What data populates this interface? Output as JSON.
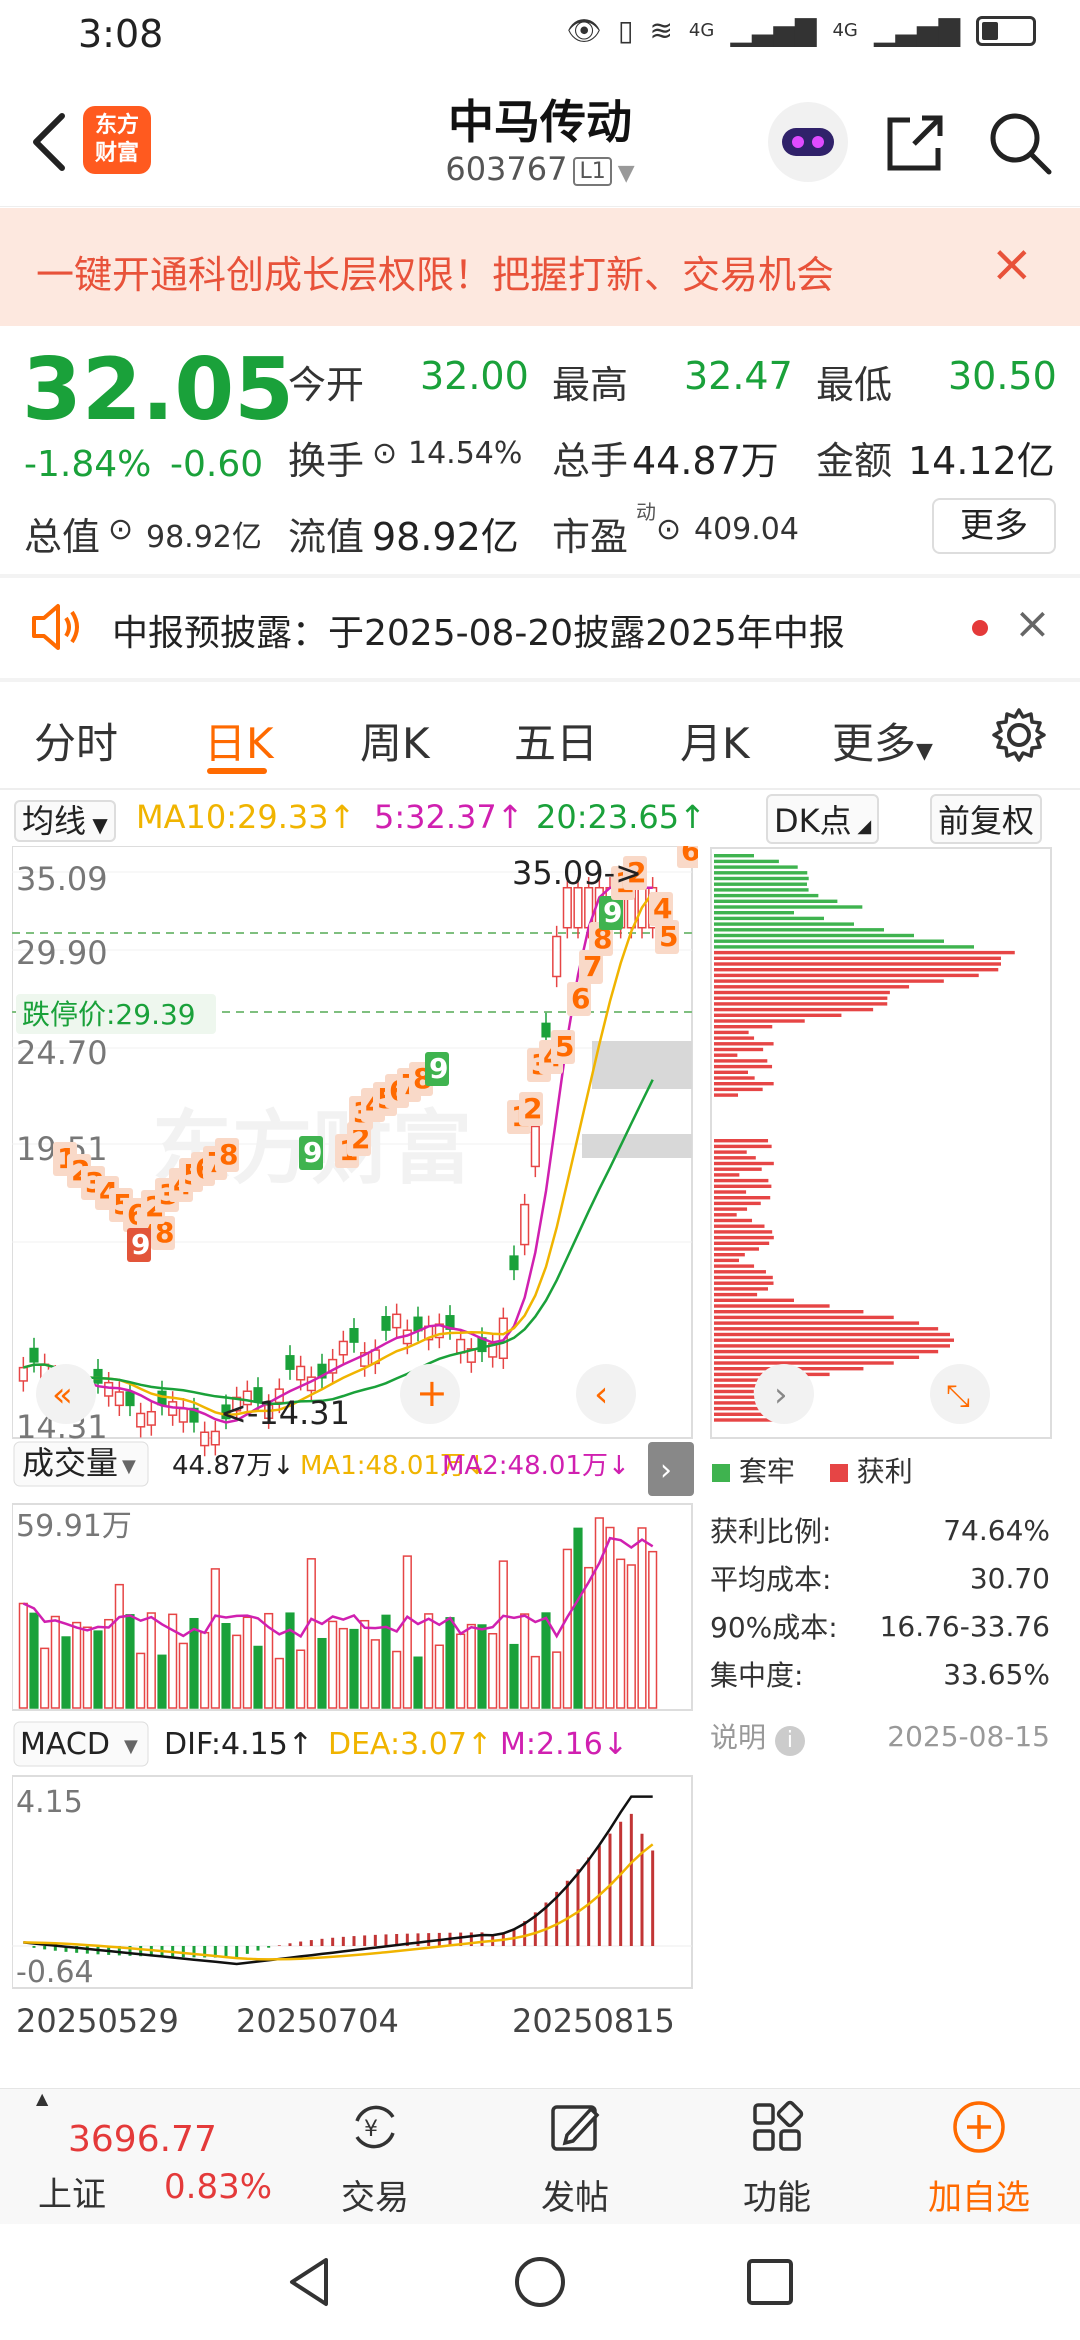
{
  "status_bar": {
    "time": "3:08",
    "signal1": "4G",
    "signal2": "4G"
  },
  "header": {
    "logo_line1": "东方",
    "logo_line2": "财富",
    "stock_name": "中马传动",
    "stock_code": "603767",
    "level_badge": "L1"
  },
  "banner": {
    "text": "一键开通科创成长层权限！把握打新、交易机会",
    "close": "×"
  },
  "quote": {
    "price": "32.05",
    "pct": "-1.84%",
    "chg": "-0.60",
    "open_label": "今开",
    "open": "32.00",
    "high_label": "最高",
    "high": "32.47",
    "low_label": "最低",
    "low": "30.50",
    "turnover_label": "换手",
    "turnover": "14.54%",
    "volume_label": "总手",
    "volume": "44.87万",
    "amount_label": "金额",
    "amount": "14.12亿",
    "mktcap_label": "总值",
    "mktcap": "98.92亿",
    "float_label": "流值",
    "float_cap": "98.92亿",
    "pe_label": "市盈",
    "pe_sup": "动",
    "pe": "409.04",
    "more": "更多"
  },
  "notice": {
    "text": "中报预披露：于2025-08-20披露2025年中报",
    "close": "×"
  },
  "tabs": [
    "分时",
    "日K",
    "周K",
    "五日",
    "月K",
    "更多"
  ],
  "ma_row": {
    "selector": "均线",
    "ma10": "MA10:29.33",
    "ma5": "5:32.37",
    "ma20": "20:23.65",
    "dk": "DK点",
    "fq": "前复权"
  },
  "kline": {
    "y_labels": [
      "35.09",
      "29.90",
      "24.70",
      "19.51",
      "14.31"
    ],
    "max_label": "35.09->",
    "min_label": "<-14.31",
    "limit_down": "跌停价:29.39",
    "watermark": "东方财富"
  },
  "volume": {
    "selector": "成交量",
    "value": "44.87万",
    "ma1": "MA1:48.01万",
    "ma2": "MA2:48.01万",
    "y_top": "59.91万"
  },
  "macd": {
    "selector": "MACD",
    "dif": "DIF:4.15",
    "dea": "DEA:3.07",
    "m": "M:2.16",
    "y_top": "4.15",
    "y_bottom": "-0.64",
    "dates": [
      "20250529",
      "20250704",
      "20250815"
    ]
  },
  "chip": {
    "legend_loss": "套牢",
    "legend_profit": "获利",
    "rows": [
      {
        "label": "获利比例:",
        "value": "74.64%"
      },
      {
        "label": "平均成本:",
        "value": "30.70"
      },
      {
        "label": "90%成本:",
        "value": "16.76-33.76"
      },
      {
        "label": "集中度:",
        "value": "33.65%"
      }
    ],
    "note": "说明",
    "date": "2025-08-15"
  },
  "bottom_nav": {
    "index_value": "3696.77",
    "index_name": "上证",
    "index_pct": "0.83%",
    "trade": "交易",
    "post": "发帖",
    "func": "功能",
    "add": "加自选"
  },
  "colors": {
    "up": "#e43a3a",
    "down": "#1aa13a",
    "accent": "#ff6a00"
  }
}
